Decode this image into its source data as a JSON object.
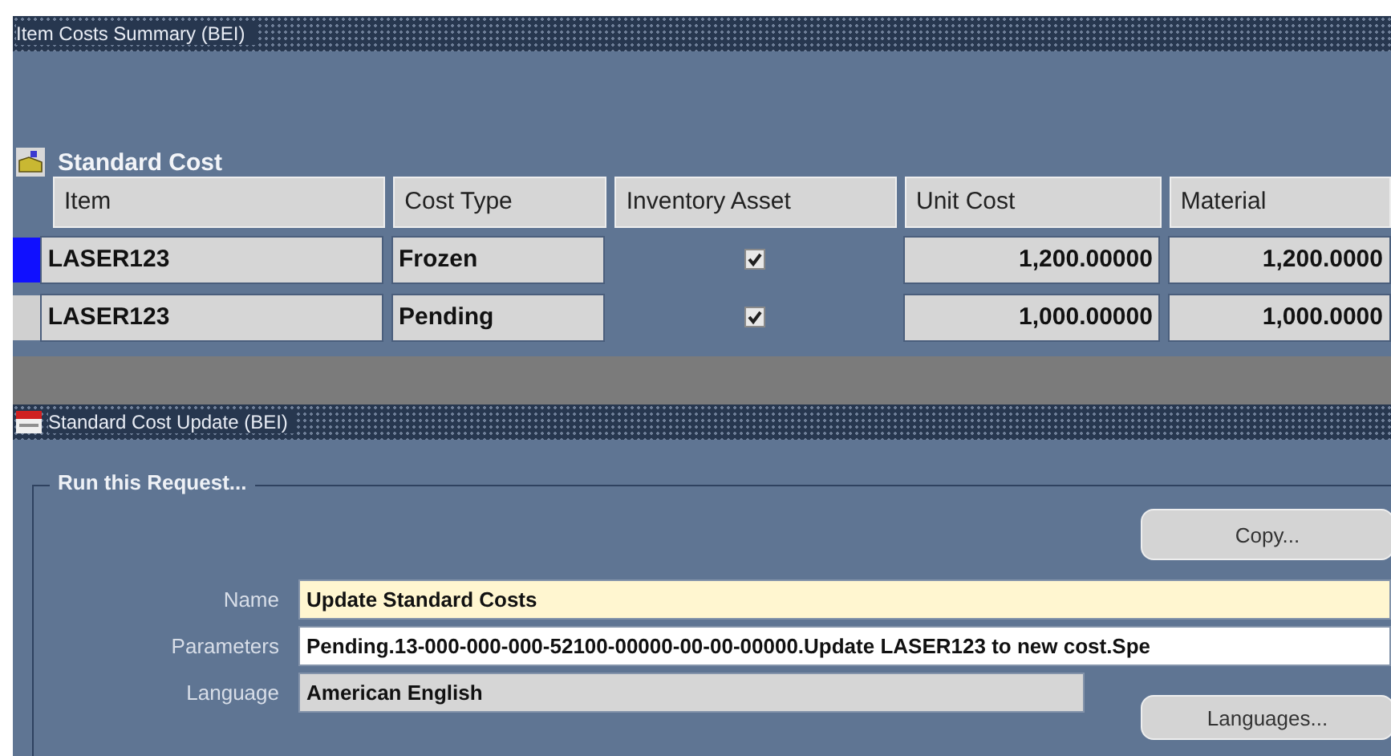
{
  "summary_window": {
    "title": "Item Costs Summary (BEI)",
    "block_title": "Standard Cost",
    "columns": [
      "Item",
      "Cost Type",
      "Inventory Asset",
      "Unit Cost",
      "Material"
    ],
    "rows": [
      {
        "item": "LASER123",
        "cost_type": "Frozen",
        "inventory_asset": true,
        "unit_cost": "1,200.00000",
        "material": "1,200.0000",
        "selected": true
      },
      {
        "item": "LASER123",
        "cost_type": "Pending",
        "inventory_asset": true,
        "unit_cost": "1,000.00000",
        "material": "1,000.0000",
        "selected": false
      }
    ]
  },
  "update_window": {
    "title": "Standard Cost Update (BEI)",
    "group_title": "Run this Request...",
    "copy_button": "Copy...",
    "fields": [
      {
        "label": "Name",
        "value": "Update Standard Costs",
        "kind": "required"
      },
      {
        "label": "Parameters",
        "value": "Pending.13-000-000-000-52100-00000-00-00-00000.Update LASER123 to new cost.Spe",
        "kind": "editable"
      },
      {
        "label": "Language",
        "value": "American English",
        "kind": "readonly"
      }
    ],
    "languages_button": "Languages..."
  }
}
